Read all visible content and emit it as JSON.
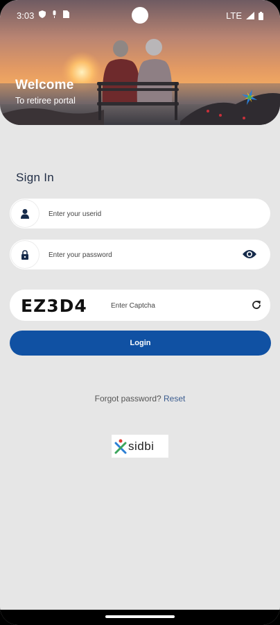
{
  "status_bar": {
    "time": "3:03",
    "network": "LTE",
    "icons": [
      "shield-icon",
      "mic-icon",
      "sim-card-icon",
      "signal-icon",
      "battery-icon"
    ]
  },
  "hero": {
    "title": "Welcome",
    "subtitle": "To retiree portal"
  },
  "signin": {
    "heading": "Sign In",
    "userid_placeholder": "Enter your userid",
    "password_placeholder": "Enter your password",
    "userid_icon": "user-icon",
    "password_icon": "lock-icon",
    "show_password_icon": "eye-icon"
  },
  "captcha": {
    "code": "EZ3D4",
    "placeholder": "Enter Captcha",
    "refresh_icon": "refresh-icon"
  },
  "login_button": "Login",
  "forgot": {
    "text": "Forgot password?",
    "link": "Reset"
  },
  "footer_logo": {
    "text": "sidbi"
  },
  "colors": {
    "primary": "#1051a3",
    "background": "#e6e6e6",
    "heading": "#1f2c44",
    "link": "#3b5c8f"
  }
}
